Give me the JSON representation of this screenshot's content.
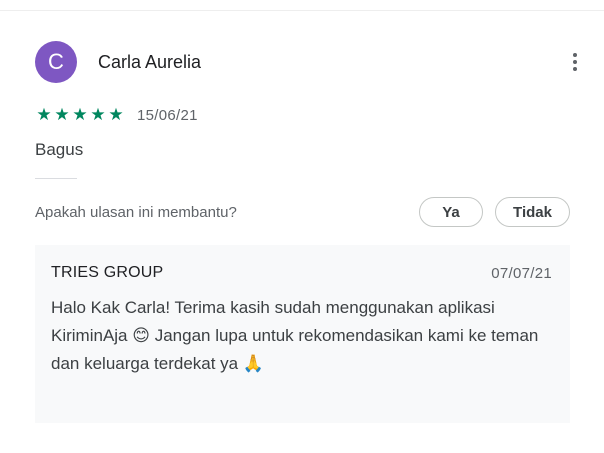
{
  "review": {
    "author_initial": "C",
    "author_name": "Carla Aurelia",
    "avatar_color": "#7e57c2",
    "star_color": "#01875f",
    "rating": 5,
    "date": "15/06/21",
    "text": "Bagus",
    "more_icon": "more-vert-icon"
  },
  "helpful": {
    "question": "Apakah ulasan ini membantu?",
    "yes_label": "Ya",
    "no_label": "Tidak"
  },
  "reply": {
    "author": "TRIES GROUP",
    "date": "07/07/21",
    "text_part1": "Halo Kak Carla! Terima kasih sudah menggunakan aplikasi KiriminAja ",
    "emoji_smile": "😊",
    "text_part2": " Jangan lupa untuk rekomendasikan kami ke teman dan keluarga terdekat ya ",
    "emoji_pray": "🙏"
  }
}
